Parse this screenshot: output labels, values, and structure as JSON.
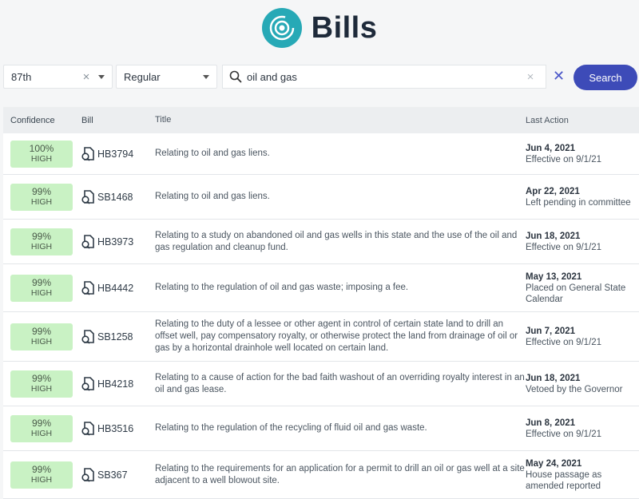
{
  "header": {
    "title": "Bills"
  },
  "filters": {
    "session": "87th",
    "session_clear": "×",
    "type": "Regular",
    "search_value": "oil and gas",
    "search_clear": "×",
    "clear_all": "✕",
    "search_button": "Search"
  },
  "table": {
    "headers": {
      "confidence": "Confidence",
      "bill": "Bill",
      "title": "Title",
      "last_action": "Last Action"
    },
    "rows": [
      {
        "confidence": "100%",
        "level": "HIGH",
        "bill": "HB3794",
        "title": "Relating to oil and gas liens.",
        "date": "Jun 4, 2021",
        "status": "Effective on 9/1/21"
      },
      {
        "confidence": "99%",
        "level": "HIGH",
        "bill": "SB1468",
        "title": "Relating to oil and gas liens.",
        "date": "Apr 22, 2021",
        "status": "Left pending in committee"
      },
      {
        "confidence": "99%",
        "level": "HIGH",
        "bill": "HB3973",
        "title": "Relating to a study on abandoned oil and gas wells in this state and the use of the oil and gas regulation and cleanup fund.",
        "date": "Jun 18, 2021",
        "status": "Effective on 9/1/21"
      },
      {
        "confidence": "99%",
        "level": "HIGH",
        "bill": "HB4442",
        "title": "Relating to the regulation of oil and gas waste; imposing a fee.",
        "date": "May 13, 2021",
        "status": "Placed on General State Calendar"
      },
      {
        "confidence": "99%",
        "level": "HIGH",
        "bill": "SB1258",
        "title": "Relating to the duty of a lessee or other agent in control of certain state land to drill an offset well, pay compensatory royalty, or otherwise protect the land from drainage of oil or gas by a horizontal drainhole well located on certain land.",
        "date": "Jun 7, 2021",
        "status": "Effective on 9/1/21"
      },
      {
        "confidence": "99%",
        "level": "HIGH",
        "bill": "HB4218",
        "title": "Relating to a cause of action for the bad faith washout of an overriding royalty interest in an oil and gas lease.",
        "date": "Jun 18, 2021",
        "status": "Vetoed by the Governor"
      },
      {
        "confidence": "99%",
        "level": "HIGH",
        "bill": "HB3516",
        "title": "Relating to the regulation of the recycling of fluid oil and gas waste.",
        "date": "Jun 8, 2021",
        "status": "Effective on 9/1/21"
      },
      {
        "confidence": "99%",
        "level": "HIGH",
        "bill": "SB367",
        "title": "Relating to the requirements for an application for a permit to drill an oil or gas well at a site adjacent to a well blowout site.",
        "date": "May 24, 2021",
        "status": "House passage as amended reported"
      }
    ]
  },
  "colors": {
    "accent": "#3d4bb8",
    "logo": "#27a9b6",
    "badge": "#c9f2c4"
  },
  "icons": {
    "logo": "target-icon",
    "search": "search-icon",
    "bill": "document-icon"
  }
}
